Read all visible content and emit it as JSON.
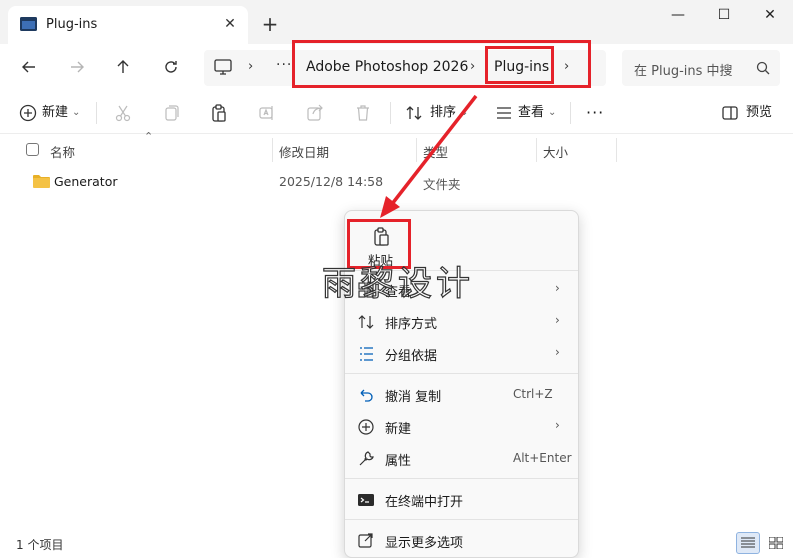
{
  "window": {
    "tab_title": "Plug-ins",
    "tab_close": "✕",
    "new_tab": "+",
    "minimize": "—",
    "maximize": "☐",
    "close": "✕"
  },
  "nav": {
    "more": "···",
    "crumbs": [
      "Adobe Photoshop 2026",
      "Plug-ins"
    ],
    "search_placeholder": "在 Plug-ins 中搜"
  },
  "toolbar": {
    "new_label": "新建",
    "sort_label": "排序",
    "view_label": "查看",
    "more": "···",
    "preview_label": "预览"
  },
  "columns": [
    "名称",
    "修改日期",
    "类型",
    "大小"
  ],
  "files": [
    {
      "name": "Generator",
      "modified": "2025/12/8 14:58",
      "type": "文件夹",
      "size": ""
    }
  ],
  "status": {
    "item_count": "1 个项目"
  },
  "context_menu": {
    "paste_label": "粘贴",
    "items": [
      {
        "icon": "view-icon",
        "label": "查看",
        "submenu": true
      },
      {
        "icon": "sort-icon",
        "label": "排序方式",
        "submenu": true
      },
      {
        "icon": "group-icon",
        "label": "分组依据",
        "submenu": true
      },
      {
        "icon": "undo-icon",
        "label": "撤消 复制",
        "shortcut": "Ctrl+Z"
      },
      {
        "icon": "new-icon",
        "label": "新建",
        "submenu": true
      },
      {
        "icon": "properties-icon",
        "label": "属性",
        "shortcut": "Alt+Enter"
      },
      {
        "icon": "terminal-icon",
        "label": "在终端中打开"
      },
      {
        "icon": "more-options-icon",
        "label": "显示更多选项"
      }
    ]
  },
  "watermark": "雨黎设计",
  "colors": {
    "highlight": "#e5222a",
    "folder": "#f4c245",
    "accent": "#005fb8"
  }
}
